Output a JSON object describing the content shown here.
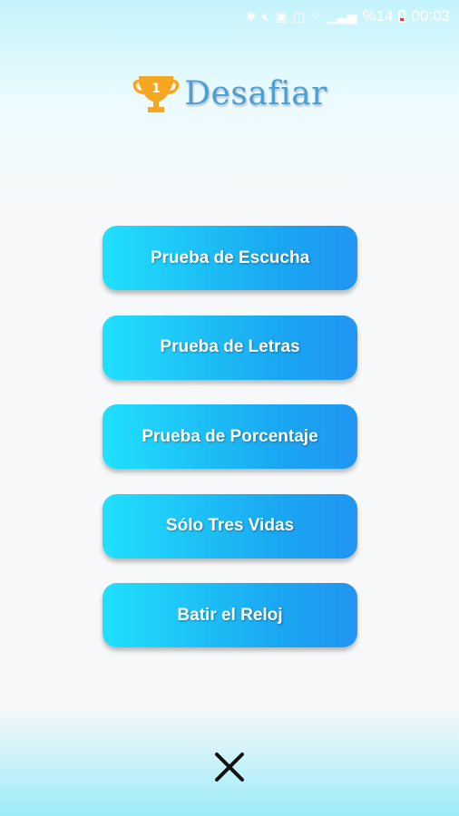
{
  "status_bar": {
    "signal_text": "%14",
    "time": "00:03"
  },
  "header": {
    "title": "Desafiar",
    "trophy_number": "1"
  },
  "menu": {
    "items": [
      {
        "label": "Prueba de Escucha"
      },
      {
        "label": "Prueba de Letras"
      },
      {
        "label": "Prueba de Porcentaje"
      },
      {
        "label": "Sólo Tres Vidas"
      },
      {
        "label": "Batir el Reloj"
      }
    ]
  },
  "colors": {
    "button_gradient_start": "#21e0fd",
    "button_gradient_end": "#2196f3",
    "title": "#4a9fd6",
    "trophy": "#f5a623"
  },
  "icons": {
    "close": "close-icon",
    "trophy": "trophy-icon"
  }
}
